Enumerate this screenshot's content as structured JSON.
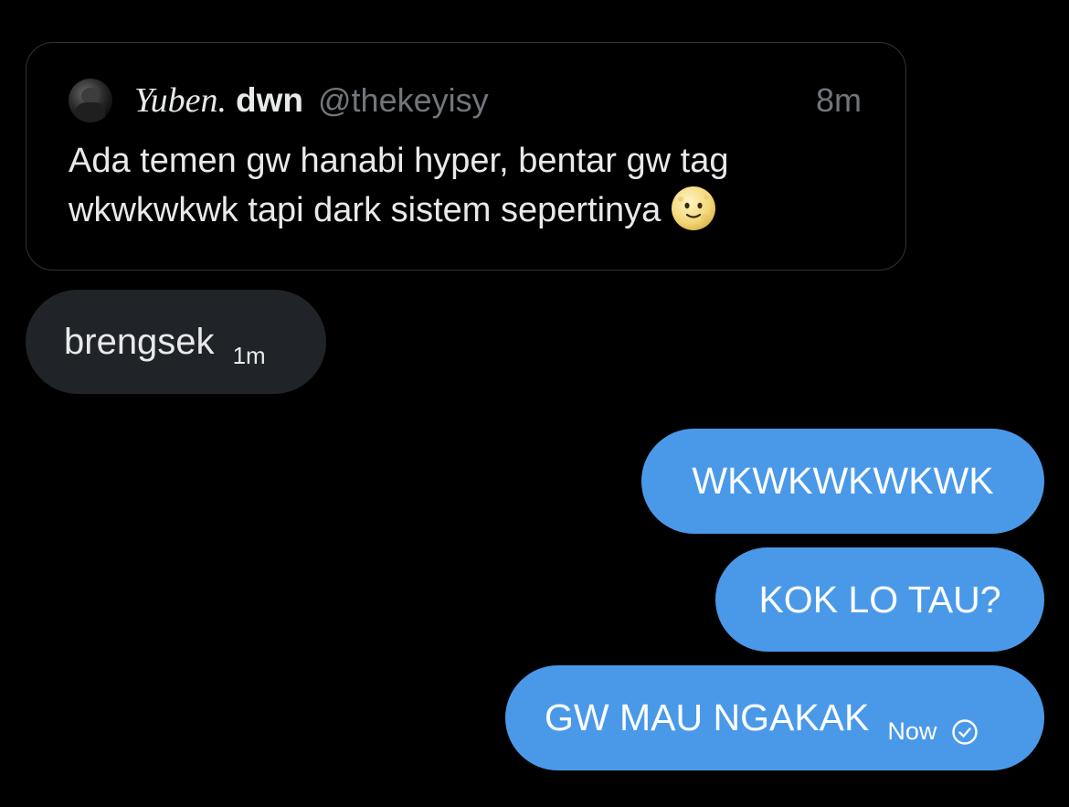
{
  "quoted_post": {
    "display_name_script": "Yuben.",
    "display_name_bold": "dwn",
    "handle": "@thekeyisy",
    "time": "8m",
    "text": "Ada temen gw hanabi hyper, bentar gw tag wkwkwkwk tapi dark sistem sepertinya",
    "emoji": "full-moon-face-emoji"
  },
  "messages": {
    "received": [
      {
        "text": "brengsek",
        "time": "1m"
      }
    ],
    "sent": [
      {
        "text": "WKWKWKWKWK"
      },
      {
        "text": "KOK LO TAU?"
      },
      {
        "text": "GW MAU NGAKAK",
        "time": "Now",
        "status_icon": "check-circle-icon"
      }
    ]
  },
  "colors": {
    "background": "#000000",
    "received_bubble": "#202327",
    "sent_bubble": "#4a99e9",
    "secondary_text": "#71767b",
    "card_border": "#2f3336"
  }
}
